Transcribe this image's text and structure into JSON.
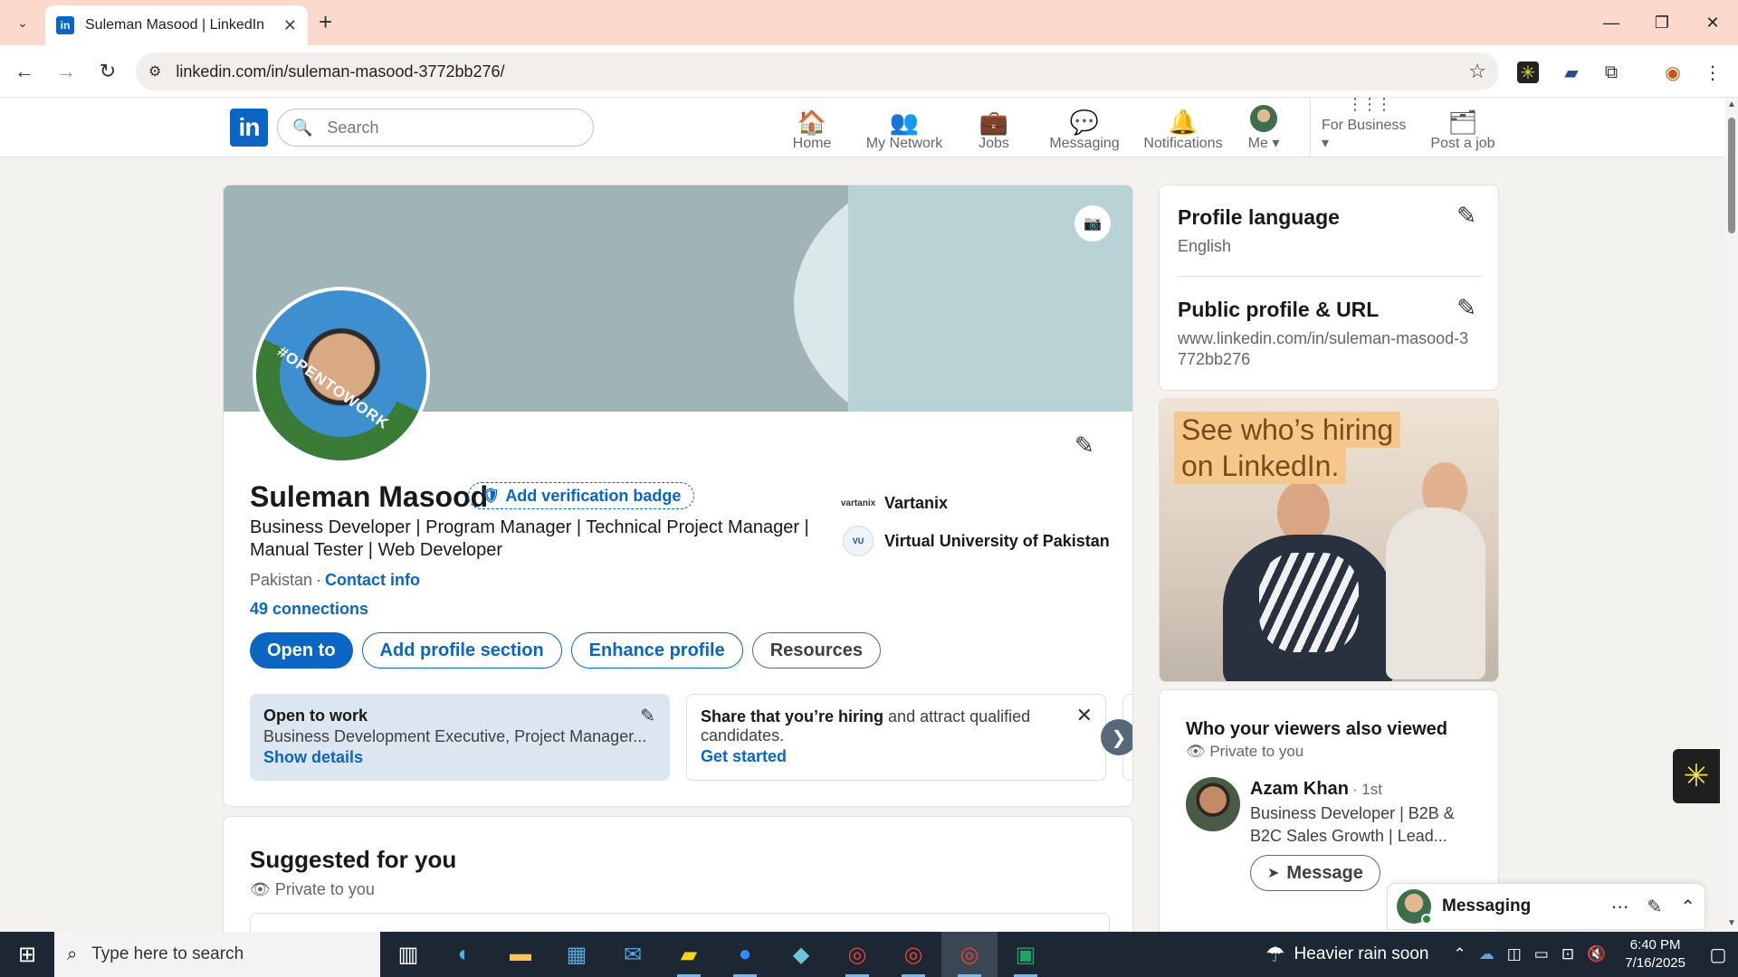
{
  "browser": {
    "tab_title": "Suleman Masood | LinkedIn",
    "tab_favicon": "in",
    "url": "linkedin.com/in/suleman-masood-3772bb276/",
    "tab_menu_icon": "⌄",
    "new_tab_icon": "+",
    "close_tab_icon": "✕",
    "minimize_icon": "—",
    "restore_icon": "❐",
    "close_window_icon": "✕",
    "back_icon": "←",
    "forward_icon": "→",
    "reload_icon": "↻",
    "star_icon": "☆"
  },
  "linkedin_nav": {
    "logo": "in",
    "search_placeholder": "Search",
    "items": [
      {
        "label": "Home",
        "icon": "🏠"
      },
      {
        "label": "My Network",
        "icon": "👥"
      },
      {
        "label": "Jobs",
        "icon": "💼"
      },
      {
        "label": "Messaging",
        "icon": "💬"
      },
      {
        "label": "Notifications",
        "icon": "🔔"
      },
      {
        "label": "Me ▾",
        "icon": ""
      },
      {
        "label": "For Business ▾",
        "icon": "⋮⋮⋮"
      },
      {
        "label": "Post a job",
        "icon": "🗂"
      }
    ]
  },
  "profile": {
    "name": "Suleman Masood",
    "verification_badge_label": "Add verification badge",
    "open_to_work_ring": "#OPENTOWORK",
    "headline": "Business Developer | Program Manager | Technical Project Manager | Manual Tester | Web Developer",
    "location": "Pakistan",
    "contact_info": "Contact info",
    "connections": "49 connections",
    "experience": {
      "company": "Vartanix",
      "logo_text": "vartanix"
    },
    "education": {
      "school": "Virtual University of Pakistan",
      "logo_text": "VU"
    },
    "actions": {
      "open_to": "Open to",
      "add_section": "Add profile section",
      "enhance": "Enhance profile",
      "resources": "Resources"
    },
    "open_to_work_box": {
      "title": "Open to work",
      "roles": "Business Development Executive, Project Manager...",
      "link": "Show details"
    },
    "hiring_box": {
      "bold": "Share that you’re hiring",
      "rest": " and attract qualified candidates.",
      "link": "Get started"
    }
  },
  "suggested": {
    "title": "Suggested for you",
    "privacy": "Private to you"
  },
  "right_rail": {
    "profile_language": {
      "title": "Profile language",
      "value": "English"
    },
    "public_profile": {
      "title": "Public profile & URL",
      "value": "www.linkedin.com/in/suleman-masood-3772bb276"
    },
    "ad": {
      "line1": "See who’s hiring",
      "line2": "on LinkedIn."
    },
    "viewers": {
      "title": "Who your viewers also viewed",
      "privacy": "Private to you",
      "person": {
        "name": "Azam Khan",
        "degree": "· 1st",
        "headline": "Business Developer | B2B & B2C Sales Growth | Lead...",
        "message_label": "Message"
      }
    }
  },
  "messaging_bar": {
    "label": "Messaging"
  },
  "taskbar": {
    "search_placeholder": "Type here to search",
    "weather": "Heavier rain soon",
    "time": "6:40 PM",
    "date": "7/16/2025"
  },
  "colors": {
    "linkedin_blue": "#0a66c2",
    "tabbar": "#fbd9cd",
    "taskbar": "#1c2733",
    "otw_box": "#dce6f1"
  }
}
